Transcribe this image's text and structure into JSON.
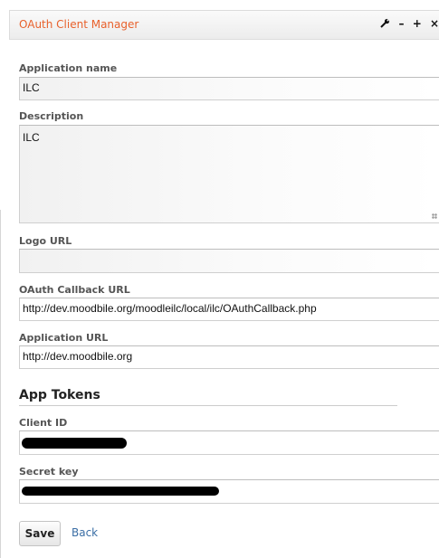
{
  "window": {
    "title": "OAuth Client Manager",
    "controls": [
      {
        "icon": "wrench-icon"
      },
      {
        "label": "–"
      },
      {
        "label": "+"
      },
      {
        "label": "×"
      }
    ],
    "accent_color": "#e8612c"
  },
  "form": {
    "application_name": {
      "label": "Application name",
      "value": "ILC"
    },
    "description": {
      "label": "Description",
      "value": "ILC"
    },
    "logo_url": {
      "label": "Logo URL",
      "value": ""
    },
    "callback_url": {
      "label": "OAuth Callback URL",
      "value": "http://dev.moodbile.org/moodleilc/local/ilc/OAuthCallback.php"
    },
    "application_url": {
      "label": "Application URL",
      "value": "http://dev.moodbile.org"
    }
  },
  "tokens": {
    "section_title": "App Tokens",
    "client_id": {
      "label": "Client ID",
      "redacted": true
    },
    "secret_key": {
      "label": "Secret key",
      "redacted": true
    }
  },
  "actions": {
    "save_label": "Save",
    "back_label": "Back"
  }
}
